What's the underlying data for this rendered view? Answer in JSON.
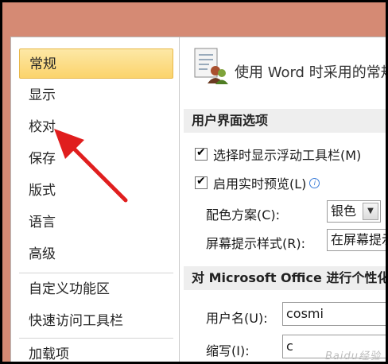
{
  "sidebar": {
    "items": [
      {
        "label": "常规",
        "selected": true
      },
      {
        "label": "显示"
      },
      {
        "label": "校对"
      },
      {
        "label": "保存"
      },
      {
        "label": "版式"
      },
      {
        "label": "语言"
      },
      {
        "label": "高级"
      },
      {
        "label": "自定义功能区"
      },
      {
        "label": "快速访问工具栏"
      },
      {
        "label": "加载项"
      }
    ]
  },
  "header": {
    "icon": "options-general-icon",
    "text": "使用 Word 时采用的常规选项。"
  },
  "sections": {
    "ui_options": "用户界面选项",
    "personalize": "对 Microsoft Office 进行个性化设置"
  },
  "ui_options": {
    "mini_toolbar": "选择时显示浮动工具栏(M)",
    "live_preview": "启用实时预览(L)",
    "color_scheme_label": "配色方案(C):",
    "color_scheme_value": "银色",
    "screentip_label": "屏幕提示样式(R):",
    "screentip_value": "在屏幕提示中显示功能说明"
  },
  "personalize": {
    "username_label": "用户名(U):",
    "username_value": "cosmi",
    "initials_label": "缩写(I):",
    "initials_value": "c"
  },
  "watermark": "Baidu经验",
  "colors": {
    "frame": "#d58a74",
    "selected": "#fbd36b",
    "arrow": "#e01e1e"
  }
}
